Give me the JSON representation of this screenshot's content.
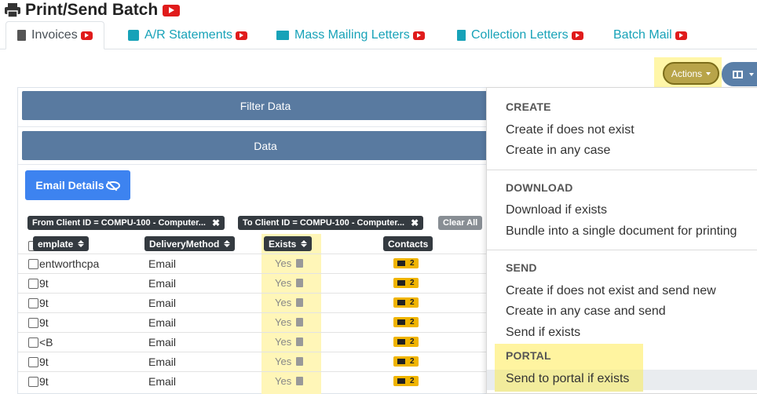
{
  "page": {
    "title": "Print/Send Batch"
  },
  "tabs": [
    {
      "label": "Invoices",
      "icon": "file-icon",
      "active": true
    },
    {
      "label": "A/R Statements",
      "icon": "id-card-icon",
      "active": false
    },
    {
      "label": "Mass Mailing Letters",
      "icon": "envelope-icon",
      "active": false
    },
    {
      "label": "Collection Letters",
      "icon": "file-icon",
      "active": false
    },
    {
      "label": "Batch Mail",
      "icon": "",
      "active": false
    }
  ],
  "toolbar": {
    "actions_label": "Actions",
    "columns_icon": "columns-icon"
  },
  "panel": {
    "filter_label": "Filter Data",
    "data_label": "Data",
    "email_details_label": "Email Details"
  },
  "filters": {
    "from_client": "From Client ID = COMPU-100 - Computer...",
    "to_client": "To Client ID = COMPU-100 - Computer...",
    "clear_all": "Clear All",
    "remove_glyph": "✖"
  },
  "table": {
    "headers": [
      "emplate",
      "DeliveryMethod",
      "Exists",
      "Contacts"
    ],
    "rows": [
      {
        "template": "entworthcpa",
        "delivery": "Email",
        "exists": "Yes",
        "contacts": "2"
      },
      {
        "template": "9t",
        "delivery": "Email",
        "exists": "Yes",
        "contacts": "2"
      },
      {
        "template": "9t",
        "delivery": "Email",
        "exists": "Yes",
        "contacts": "2"
      },
      {
        "template": "9t",
        "delivery": "Email",
        "exists": "Yes",
        "contacts": "2"
      },
      {
        "template": "<B",
        "delivery": "Email",
        "exists": "Yes",
        "contacts": "2"
      },
      {
        "template": "9t",
        "delivery": "Email",
        "exists": "Yes",
        "contacts": "2"
      },
      {
        "template": "9t",
        "delivery": "Email",
        "exists": "Yes",
        "contacts": "2"
      }
    ]
  },
  "menu": {
    "create_header": "CREATE",
    "create_items": [
      "Create if does not exist",
      "Create in any case"
    ],
    "download_header": "DOWNLOAD",
    "download_items": [
      "Download if exists",
      "Bundle into a single document for printing"
    ],
    "send_header": "SEND",
    "send_items": [
      "Create if does not exist and send new",
      "Create in any case and send",
      "Send if exists"
    ],
    "portal_header": "PORTAL",
    "portal_items": [
      "Send to portal if exists"
    ]
  },
  "colors": {
    "bar": "#597aa0",
    "actions_btn": "#b8a449",
    "highlight": "#fff6a8",
    "email_btn": "#3d83f0",
    "contacts_badge": "#f0b400",
    "tab_link": "#17a2b8"
  }
}
